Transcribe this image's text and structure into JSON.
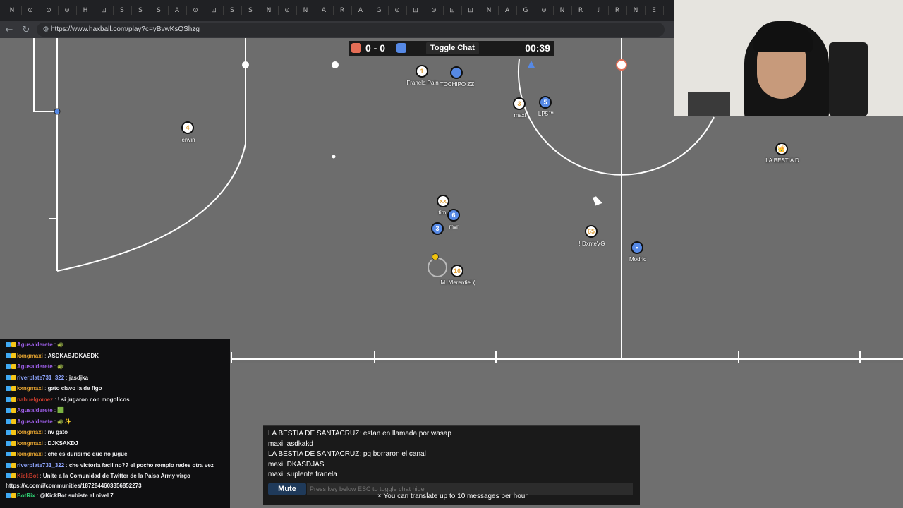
{
  "browser": {
    "url": "https://www.haxball.com/play?c=yBvwKsQShzg",
    "tab_glyphs": [
      "N",
      "⊙",
      "⊙",
      "⊙",
      "H",
      "⊡",
      "S",
      "S",
      "S",
      "A",
      "⊙",
      "⊡",
      "S",
      "S",
      "N",
      "⊙",
      "N",
      "A",
      "R",
      "A",
      "G",
      "⊙",
      "⊡",
      "⊙",
      "⊡",
      "⊡",
      "N",
      "A",
      "G",
      "⊙",
      "N",
      "R",
      "♪",
      "R",
      "N",
      "E"
    ]
  },
  "scoreboard": {
    "red_color": "#e56e56",
    "blue_color": "#5689e5",
    "score": "0 - 0",
    "toggle_chat_label": "Toggle Chat",
    "timer": "00:39"
  },
  "players": [
    {
      "team": "red",
      "avatar": "1",
      "name": "Franela Pain"
    },
    {
      "team": "blue",
      "avatar": "—",
      "name": "TOCHIPO ZZ"
    },
    {
      "team": "red",
      "avatar": "3",
      "name": "maxi"
    },
    {
      "team": "blue",
      "avatar": "5",
      "name": "LP5™"
    },
    {
      "team": "red",
      "avatar": "4",
      "name": "erwin"
    },
    {
      "team": "red",
      "avatar": "👑",
      "name": "LA BESTIA D"
    },
    {
      "team": "red",
      "avatar": "xx",
      "name": "tim"
    },
    {
      "team": "blue",
      "avatar": "6",
      "name": ""
    },
    {
      "team": "blue",
      "avatar": "3",
      "name": "mvr"
    },
    {
      "team": "red",
      "avatar": "65",
      "name": "! DxnteVG"
    },
    {
      "team": "blue",
      "avatar": "•",
      "name": "Modric"
    },
    {
      "team": "red",
      "avatar": "16",
      "name": "M. Merentiel ("
    }
  ],
  "twitch_chat": [
    {
      "user": "Agusalderete",
      "color": "#9b5de5",
      "msg": "🐢"
    },
    {
      "user": "kxngmaxi",
      "color": "#e0a030",
      "msg": "ASDKASJDKASDK"
    },
    {
      "user": "Agusalderete",
      "color": "#9b5de5",
      "msg": "🐢"
    },
    {
      "user": "riverplate731_322",
      "color": "#8fa6ff",
      "msg": "jasdjka"
    },
    {
      "user": "kxngmaxi",
      "color": "#e0a030",
      "msg": "gato clavo la de figo"
    },
    {
      "user": "nahuelgomez",
      "color": "#c0392b",
      "msg": "! si jugaron con mogolicos"
    },
    {
      "user": "Agusalderete",
      "color": "#9b5de5",
      "msg": "🟩"
    },
    {
      "user": "Agusalderete",
      "color": "#9b5de5",
      "msg": "🐢✨"
    },
    {
      "user": "kxngmaxi",
      "color": "#e0a030",
      "msg": "nv gato"
    },
    {
      "user": "kxngmaxi",
      "color": "#e0a030",
      "msg": "DJKSAKDJ"
    },
    {
      "user": "kxngmaxi",
      "color": "#e0a030",
      "msg": "che es durisimo que no jugue"
    },
    {
      "user": "riverplate731_322",
      "color": "#8fa6ff",
      "msg": "che victoria facil no?? el pocho rompio redes otra vez"
    },
    {
      "user": "KickBot",
      "color": "#c0392b",
      "msg": "Unite a la Comunidad de Twitter de la Paisa Army virgo https://x.com/i/communities/1872844603356852273"
    },
    {
      "user": "BotRix",
      "color": "#2ecc71",
      "msg": "@KickBot subiste al nivel 7"
    }
  ],
  "hax_chat": {
    "messages": [
      "LA BESTIA DE SANTACRUZ: estan en llamada por wasap",
      "maxi: asdkakd",
      "LA BESTIA DE SANTACRUZ: pq borraron el canal",
      "maxi: DKASDJAS",
      "maxi: suplente franela"
    ],
    "mute_label": "Mute",
    "input_placeholder": "Press key below ESC to toggle chat hide",
    "translate_note": "× You can translate up to 10 messages per hour."
  }
}
